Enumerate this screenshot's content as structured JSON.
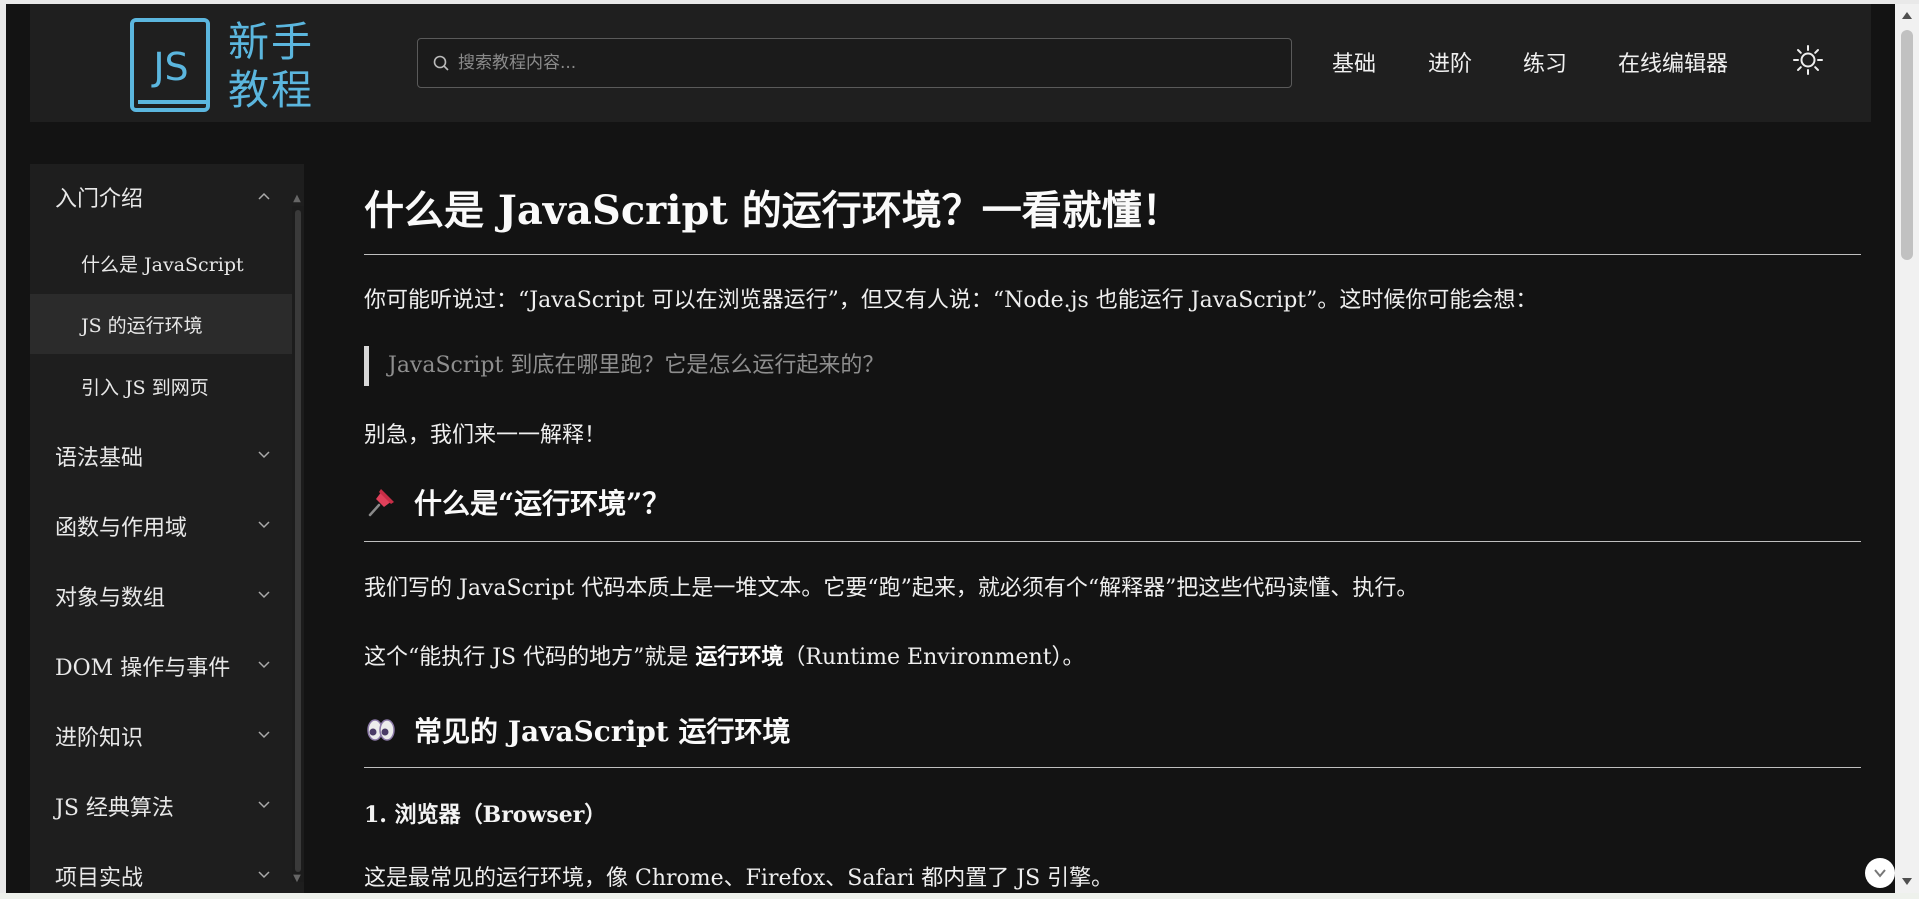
{
  "header": {
    "logo_mark": "JS",
    "logo_line1": "新手",
    "logo_line2": "教程",
    "search_placeholder": "搜索教程内容...",
    "nav": [
      "基础",
      "进阶",
      "练习",
      "在线编辑器"
    ],
    "theme_icon": "sun-icon"
  },
  "sidebar": {
    "groups": [
      {
        "label": "入门介绍",
        "expanded": true,
        "items": [
          "什么是 JavaScript",
          "JS 的运行环境",
          "引入 JS 到网页"
        ],
        "active_item": "JS 的运行环境"
      },
      {
        "label": "语法基础",
        "expanded": false
      },
      {
        "label": "函数与作用域",
        "expanded": false
      },
      {
        "label": "对象与数组",
        "expanded": false
      },
      {
        "label": "DOM 操作与事件",
        "expanded": false
      },
      {
        "label": "进阶知识",
        "expanded": false
      },
      {
        "label": "JS 经典算法",
        "expanded": false
      },
      {
        "label": "项目实战",
        "expanded": false
      }
    ]
  },
  "article": {
    "title": "什么是 JavaScript 的运行环境？一看就懂！",
    "intro": "你可能听说过：“JavaScript 可以在浏览器运行”，但又有人说：“Node.js 也能运行 JavaScript”。这时候你可能会想：",
    "quote": "JavaScript 到底在哪里跑？它是怎么运行起来的？",
    "p_calm": "别急，我们来一一解释！",
    "h2_what": "什么是“运行环境”？",
    "h2_what_icon": "pushpin-icon",
    "p_text1": "我们写的 JavaScript 代码本质上是一堆文本。它要“跑”起来，就必须有个“解释器”把这些代码读懂、执行。",
    "p_text2_before": "这个“能执行 JS 代码的地方”就是 ",
    "p_text2_bold": "运行环境",
    "p_text2_after": "（Runtime Environment）。",
    "h2_common": "常见的 JavaScript 运行环境",
    "h2_common_icon": "eyes-icon",
    "h3_browser": "1. 浏览器（Browser）",
    "p_browser": "这是最常见的运行环境，像 Chrome、Firefox、Safari 都内置了 JS 引擎。"
  },
  "colors": {
    "background": "#131313",
    "header": "#1f1f1f",
    "sidebar": "#1e1e1e",
    "accent": "#5bb6de",
    "pin": "#e0405a"
  }
}
